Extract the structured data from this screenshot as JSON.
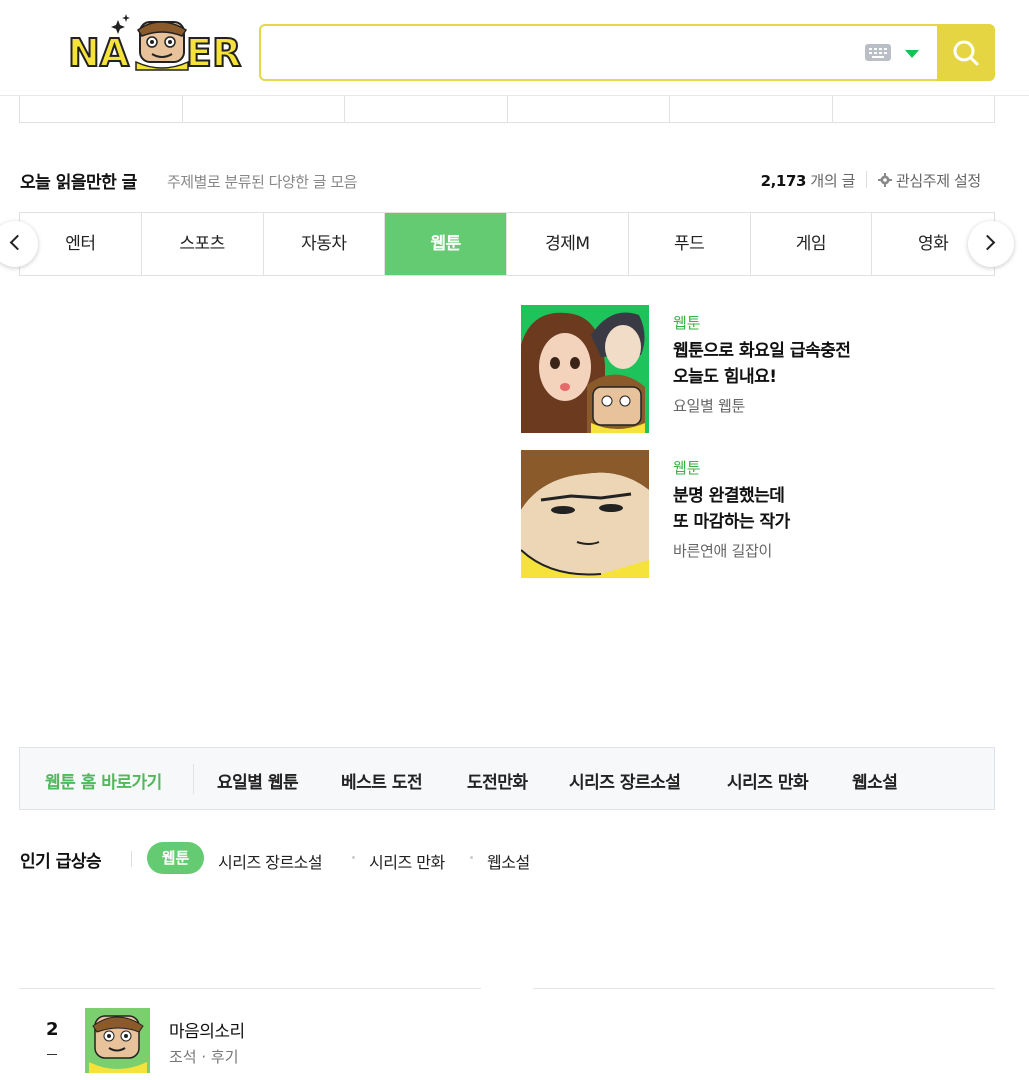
{
  "header": {
    "logo_text": "NAVER"
  },
  "section": {
    "title": "오늘 읽을만한 글",
    "subtitle": "주제별로 분류된 다양한 글 모음",
    "count": "2,173",
    "count_suffix": "개의 글",
    "setting_label": "관심주제 설정"
  },
  "tabs": [
    {
      "label": "엔터"
    },
    {
      "label": "스포츠"
    },
    {
      "label": "자동차"
    },
    {
      "label": "웹툰"
    },
    {
      "label": "경제M"
    },
    {
      "label": "푸드"
    },
    {
      "label": "게임"
    },
    {
      "label": "영화"
    }
  ],
  "cards": [
    {
      "category": "웹툰",
      "title_line1": "웹툰으로 화요일 급속충전",
      "title_line2": "오늘도 힘내요!",
      "source": "요일별 웹툰"
    },
    {
      "category": "웹툰",
      "title_line1": "분명 완결했는데",
      "title_line2": "또 마감하는 작가",
      "source": "바른연애 길잡이"
    }
  ],
  "webtoon_nav": {
    "home": "웹툰 홈 바로가기",
    "items": [
      "요일별 웹툰",
      "베스트 도전",
      "도전만화",
      "시리즈 장르소설",
      "시리즈 만화",
      "웹소설"
    ]
  },
  "rising": {
    "title": "인기 급상승",
    "active_tab": "웹툰",
    "tabs": [
      "시리즈 장르소설",
      "시리즈 만화",
      "웹소설"
    ]
  },
  "ranking": [
    {
      "rank": "2",
      "title": "마음의소리",
      "author": "조석",
      "tag": "후기"
    }
  ],
  "colors": {
    "accent_green": "#64cb72",
    "search_yellow": "#e5d543"
  }
}
